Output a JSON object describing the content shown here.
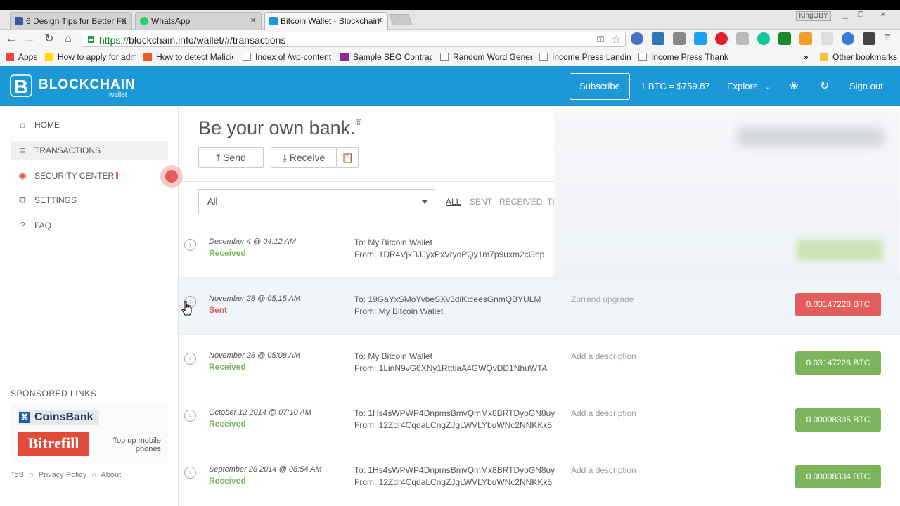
{
  "browser": {
    "tabs": [
      {
        "label": "6 Design Tips for Better Fa",
        "color": "#3b5998"
      },
      {
        "label": "WhatsApp",
        "color": "#25d366"
      },
      {
        "label": "Bitcoin Wallet - Blockchain",
        "color": "#1d98d6"
      }
    ],
    "window_user": "KingOBY",
    "url_https": "https://",
    "url_rest": "blockchain.info/wallet/#/transactions",
    "bookmarks": [
      "Apps",
      "How to apply for adm",
      "How to detect Malicio",
      "Index of /wp-content",
      "Sample SEO Contract",
      "Random Word Gener",
      "Income Press Landing",
      "Income Press Thank Y"
    ],
    "other_bookmarks": "Other bookmarks"
  },
  "header": {
    "logo_text": "BLOCKCHAIN",
    "logo_sub": "wallet",
    "subscribe": "Subscribe",
    "rate": "1 BTC =  $759.87",
    "explore": "Explore",
    "signout": "Sign out"
  },
  "sidebar": {
    "items": [
      {
        "label": "HOME",
        "icon": "home-icon"
      },
      {
        "label": "TRANSACTIONS",
        "icon": "list-icon"
      },
      {
        "label": "SECURITY CENTER",
        "icon": "lock-icon"
      },
      {
        "label": "SETTINGS",
        "icon": "gear-icon"
      },
      {
        "label": "FAQ",
        "icon": "help-icon"
      }
    ],
    "sponsored_title": "SPONSORED LINKS",
    "coinsbank": "CoinsBank",
    "bitrefill": "Bitrefill",
    "topup": "Top up mobile phones",
    "footer": {
      "tos": "ToS",
      "privacy": "Privacy Policy",
      "about": "About"
    }
  },
  "main": {
    "title": "Be your own bank.",
    "title_mark": "®",
    "send": "Send",
    "receive": "Receive",
    "filter_value": "All",
    "filter_tabs": [
      "ALL",
      "SENT",
      "RECEIVED",
      "TI"
    ]
  },
  "transactions": [
    {
      "date": "December 4 @ 04:12 AM",
      "status": "Received",
      "to": "To: My Bitcoin Wallet",
      "from": "From: 1DR4VjkBJJyxPxVryoPQy1m7p9uxm2cGbp",
      "desc": "",
      "amount": ""
    },
    {
      "date": "November 28 @ 05:15 AM",
      "status": "Sent",
      "to": "To: 19GaYxSMoYvbeSXv3diKtceesGnmQBYULM",
      "from": "From: My Bitcoin Wallet",
      "desc": "Zurrand upgrade",
      "amount": "0.03147228 BTC"
    },
    {
      "date": "November 28 @ 05:08 AM",
      "status": "Received",
      "to": "To: My Bitcoin Wallet",
      "from": "From: 1LinN9vG6XNy1RtttiaA4GWQvDD1NhuWTA",
      "desc": "Add a description",
      "amount": "0.03147228 BTC"
    },
    {
      "date": "October 12 2014 @ 07:10 AM",
      "status": "Received",
      "to": "To: 1Hs4sWPWP4DnpmsBmvQmMx8BRTDyoGN8uy",
      "from": "From: 12Zdr4CqdaLCngZJgLWVLYbuWNc2NNKKk5",
      "desc": "Add a description",
      "amount": "0.00008305 BTC"
    },
    {
      "date": "September 28 2014 @ 08:54 AM",
      "status": "Received",
      "to": "To: 1Hs4sWPWP4DnpmsBmvQmMx8BRTDyoGN8uy",
      "from": "From: 12Zdr4CqdaLCngZJgLWVLYbuWNc2NNKKk5",
      "desc": "Add a description",
      "amount": "0.00008334 BTC"
    }
  ],
  "colors": {
    "brand": "#1d98d6",
    "received": "#7ab55c",
    "sent": "#e35d5d"
  }
}
